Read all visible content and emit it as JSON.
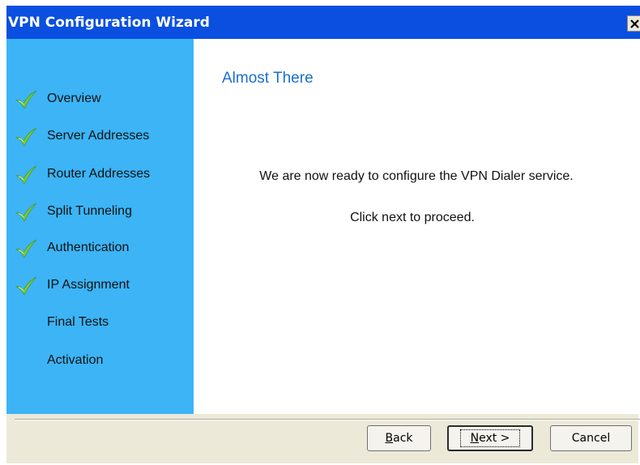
{
  "window": {
    "title": "VPN Configuration Wizard",
    "close_label": "close"
  },
  "sidebar": {
    "items": [
      {
        "label": "Overview",
        "completed": true
      },
      {
        "label": "Server Addresses",
        "completed": true
      },
      {
        "label": "Router Addresses",
        "completed": true
      },
      {
        "label": "Split Tunneling",
        "completed": true
      },
      {
        "label": "Authentication",
        "completed": true
      },
      {
        "label": "IP Assignment",
        "completed": true
      },
      {
        "label": "Final Tests",
        "completed": false
      },
      {
        "label": "Activation",
        "completed": false
      }
    ]
  },
  "main": {
    "heading": "Almost There",
    "message": "We are now ready to configure the VPN Dialer service.",
    "instruction": "Click next to proceed."
  },
  "buttons": {
    "back": {
      "mnemonic": "B",
      "rest": "ack"
    },
    "next": {
      "mnemonic": "N",
      "rest": "ext >"
    },
    "cancel": "Cancel"
  },
  "colors": {
    "titlebar": "#0a4fe0",
    "sidebar": "#3cb4f6",
    "heading": "#1a6fd0",
    "checkmark": "#7ac943"
  },
  "icons": {
    "completed": "checkmark-icon",
    "close": "close-icon"
  }
}
